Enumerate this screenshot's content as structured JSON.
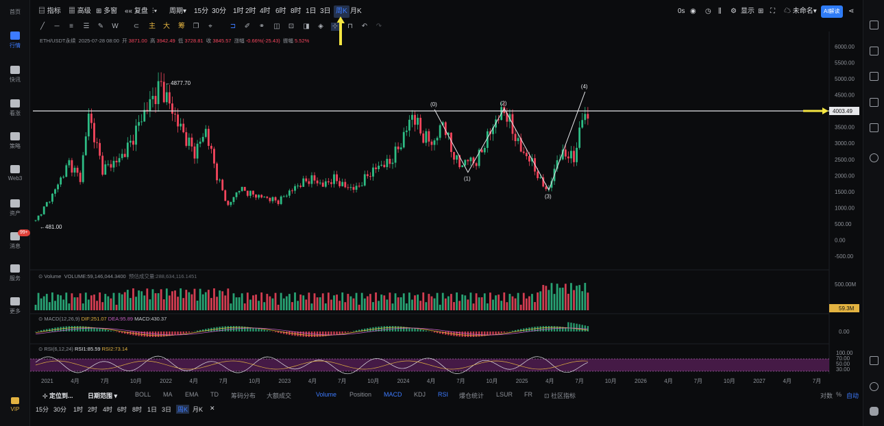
{
  "left_sidebar": {
    "items": [
      {
        "label": "首页",
        "icon": "home-icon"
      },
      {
        "label": "行情",
        "icon": "chart-bars-icon",
        "active": true
      },
      {
        "label": "快讯",
        "icon": "news-icon"
      },
      {
        "label": "看涨",
        "icon": "bullish-icon"
      },
      {
        "label": "策略",
        "icon": "strategy-icon"
      },
      {
        "label": "Web3",
        "icon": "web3-icon"
      },
      {
        "label": "资产",
        "icon": "wallet-icon"
      },
      {
        "label": "消息",
        "icon": "message-icon",
        "badge": "99+"
      },
      {
        "label": "服务",
        "icon": "service-icon"
      },
      {
        "label": "更多",
        "icon": "more-icon"
      },
      {
        "label": "VIP",
        "icon": "vip-icon"
      }
    ]
  },
  "top_bar": {
    "indicators": "指标",
    "advanced": "高级",
    "multi_chart": "多窗",
    "replay": "复盘",
    "chart_style": "⌂",
    "period_label": "周期",
    "intervals": [
      "15分",
      "30分",
      "1时",
      "2时",
      "4时",
      "6时",
      "8时",
      "1日",
      "3日",
      "周K",
      "月K"
    ],
    "selected_interval": "周K",
    "countdown": "0s",
    "display": "显示",
    "account": "未命名",
    "ai_button": "AI解读"
  },
  "legend": {
    "symbol": "ETH/USDT永续",
    "date": "2025-07-28 08:00",
    "open_label": "开",
    "open": "3871.00",
    "high_label": "高",
    "high": "3942.49",
    "low_label": "低",
    "low": "3728.81",
    "close_label": "收",
    "close": "3845.57",
    "change_label": "涨幅",
    "change": "-0.66%(-25.43)",
    "amp_label": "振幅",
    "amp": "5.52%"
  },
  "price_axis": [
    "6000.00",
    "5500.00",
    "5000.00",
    "4500.00",
    "4000.00",
    "3500.00",
    "3000.00",
    "2500.00",
    "2000.00",
    "1500.00",
    "1000.00",
    "500.00",
    "0.00",
    "-500.00"
  ],
  "hline_price": "4003.49",
  "extremes": {
    "high": "4877.70",
    "low": "481.00"
  },
  "wave_labels": [
    "(0)",
    "(1)",
    "(2)",
    "(3)",
    "(4)"
  ],
  "volume": {
    "label": "Volume",
    "text": "VOLUME:59,146,044.3400",
    "estimate": "预估成交量:288,634,116.1451",
    "axis_max": "500.00M",
    "last": "59.3M"
  },
  "macd": {
    "label": "MACD(12,26,9)",
    "dif": "DIF:251.07",
    "dea": "DEA:95.89",
    "macd": "MACD:430.37",
    "axis": "0.00"
  },
  "rsi": {
    "label": "RSI(6,12,24)",
    "rsi1": "RSI1:85.59",
    "rsi2": "RSI2:73.14",
    "axis": [
      "100.00",
      "70.00",
      "50.00",
      "30.00"
    ]
  },
  "time_axis": [
    "2021",
    "4月",
    "7月",
    "10月",
    "2022",
    "4月",
    "7月",
    "10月",
    "2023",
    "4月",
    "7月",
    "10月",
    "2024",
    "4月",
    "7月",
    "10月",
    "2025",
    "4月",
    "7月",
    "10月",
    "2026",
    "4月",
    "7月",
    "10月",
    "2027",
    "4月",
    "7月"
  ],
  "indicator_bar": {
    "position_tool": "定位到...",
    "date_range": "日期范围",
    "main": [
      "BOLL",
      "MA",
      "EMA",
      "TD",
      "筹码分布",
      "大额成交"
    ],
    "sub": [
      "Volume",
      "Position",
      "MACD",
      "KDJ",
      "RSI",
      "爆仓统计",
      "LSUR",
      "FR",
      "社区指标"
    ],
    "sub_active": [
      "Volume",
      "MACD",
      "RSI"
    ],
    "log": "对数",
    "auto": "自动"
  },
  "interval_bar": {
    "items": [
      "15分",
      "30分",
      "1时",
      "2时",
      "4时",
      "6时",
      "8时",
      "1日",
      "3日",
      "周K",
      "月K",
      "✕"
    ],
    "selected": "周K"
  },
  "colors": {
    "up": "#2ebd85",
    "down": "#f6465d",
    "accent": "#3d7bff",
    "arrow": "#f5e642",
    "rsi_band": "#5a1f5a"
  }
}
